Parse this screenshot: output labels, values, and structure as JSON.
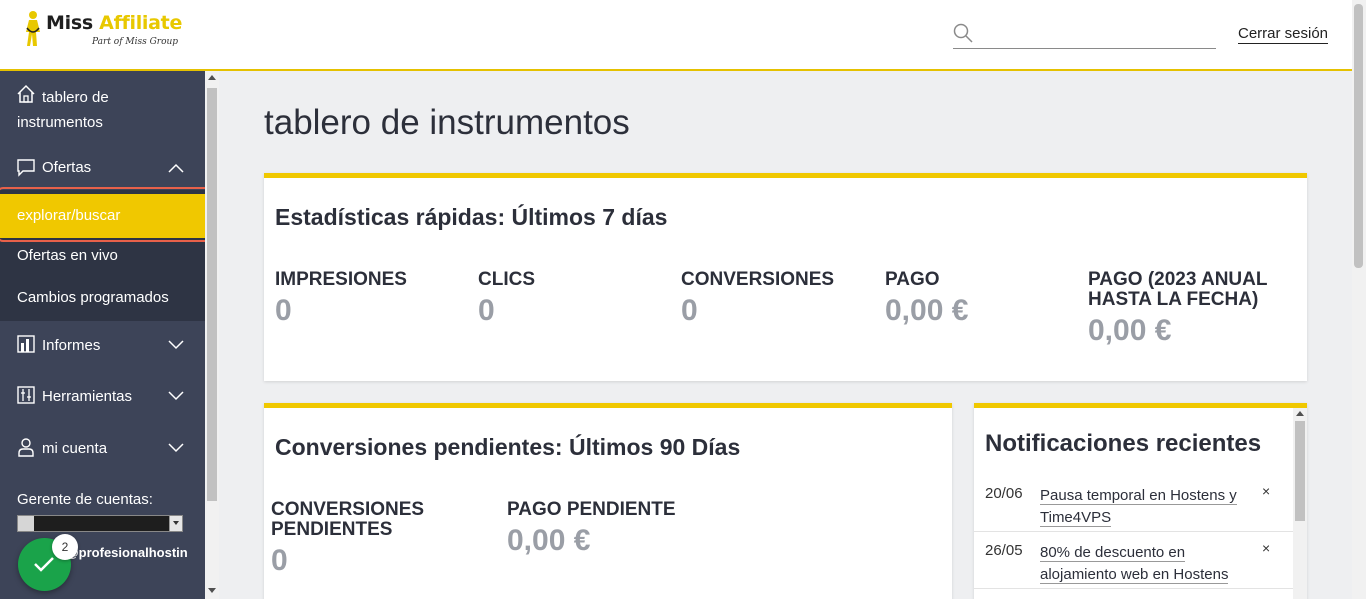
{
  "header": {
    "logo_main": "Miss",
    "logo_accent": "Affiliate",
    "logo_sub": "Part of Miss Group",
    "search_placeholder": "",
    "logout_label": "Cerrar sesión"
  },
  "sidebar": {
    "dashboard_label": "tablero de instrumentos",
    "offers_label": "Ofertas",
    "offers_sub": [
      {
        "label": "explorar/buscar",
        "active": true
      },
      {
        "label": "Ofertas en vivo",
        "active": false
      },
      {
        "label": "Cambios programados",
        "active": false
      }
    ],
    "reports_label": "Informes",
    "tools_label": "Herramientas",
    "account_label": "mi cuenta",
    "manager_label": "Gerente de cuentas:",
    "manager_email": "@profesionalhostin",
    "fab_badge": "2",
    "accent_color": "#f0c800"
  },
  "main": {
    "page_title": "tablero de instrumentos",
    "quick_stats": {
      "title": "Estadísticas rápidas: Últimos 7 días",
      "items": [
        {
          "label": "IMPRESIONES",
          "value": "0"
        },
        {
          "label": "CLICS",
          "value": "0"
        },
        {
          "label": "CONVERSIONES",
          "value": "0"
        },
        {
          "label": "PAGO",
          "value": "0,00 €"
        },
        {
          "label": "PAGO (2023 ANUAL HASTA LA FECHA)",
          "value": "0,00 €"
        }
      ]
    },
    "pending": {
      "title": "Conversiones pendientes: Últimos 90 Días",
      "items": [
        {
          "label": "CONVERSIONES PENDIENTES",
          "value": "0"
        },
        {
          "label": "PAGO PENDIENTE",
          "value": "0,00 €"
        }
      ]
    },
    "notifications": {
      "title": "Notificaciones recientes",
      "items": [
        {
          "date": "20/06",
          "text": "Pausa temporal en Hostens y Time4VPS",
          "close": "×"
        },
        {
          "date": "26/05",
          "text": "80% de descuento en alojamiento web en Hostens",
          "close": "×"
        }
      ]
    }
  }
}
